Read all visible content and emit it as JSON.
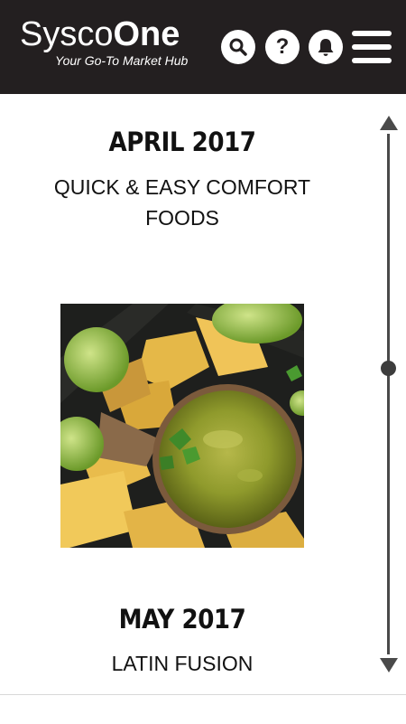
{
  "header": {
    "brand_light": "Sysco",
    "brand_bold": "One",
    "tagline": "Your Go-To Market Hub",
    "help_glyph": "?",
    "icons": [
      "search-icon",
      "help-icon",
      "bell-icon",
      "menu-icon"
    ],
    "background": "#231f20"
  },
  "issues": [
    {
      "month": "APRIL 2017",
      "title": "QUICK & EASY COMFORT FOODS"
    },
    {
      "month": "MAY 2017",
      "title": "LATIN FUSION"
    }
  ],
  "scrollbar": {
    "position_fraction": 0.45
  }
}
